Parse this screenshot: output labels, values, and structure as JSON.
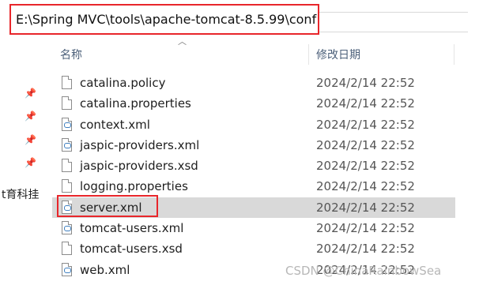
{
  "address": {
    "path": "E:\\Spring MVC\\tools\\apache-tomcat-8.5.99\\conf"
  },
  "columns": {
    "name": "名称",
    "modified": "修改日期"
  },
  "sidebar": {
    "fragment": "t育科挂"
  },
  "files": [
    {
      "name": "catalina.policy",
      "date": "2024/2/14 22:52",
      "icon": "file-icon"
    },
    {
      "name": "catalina.properties",
      "date": "2024/2/14 22:52",
      "icon": "file-icon"
    },
    {
      "name": "context.xml",
      "date": "2024/2/14 22:52",
      "icon": "xml-file-icon"
    },
    {
      "name": "jaspic-providers.xml",
      "date": "2024/2/14 22:52",
      "icon": "xml-file-icon"
    },
    {
      "name": "jaspic-providers.xsd",
      "date": "2024/2/14 22:52",
      "icon": "file-icon"
    },
    {
      "name": "logging.properties",
      "date": "2024/2/14 22:52",
      "icon": "file-icon"
    },
    {
      "name": "server.xml",
      "date": "2024/2/14 22:52",
      "icon": "xml-file-icon"
    },
    {
      "name": "tomcat-users.xml",
      "date": "2024/2/14 22:52",
      "icon": "xml-file-icon"
    },
    {
      "name": "tomcat-users.xsd",
      "date": "2024/2/14 22:52",
      "icon": "file-icon"
    },
    {
      "name": "web.xml",
      "date": "2024/2/14 22:52",
      "icon": "xml-file-icon"
    }
  ],
  "watermark": "CSDN @ChinaRainbowSea",
  "colors": {
    "highlight": "#e8262b",
    "selected_row": "#d9d9d9",
    "header_text": "#4c607a"
  }
}
